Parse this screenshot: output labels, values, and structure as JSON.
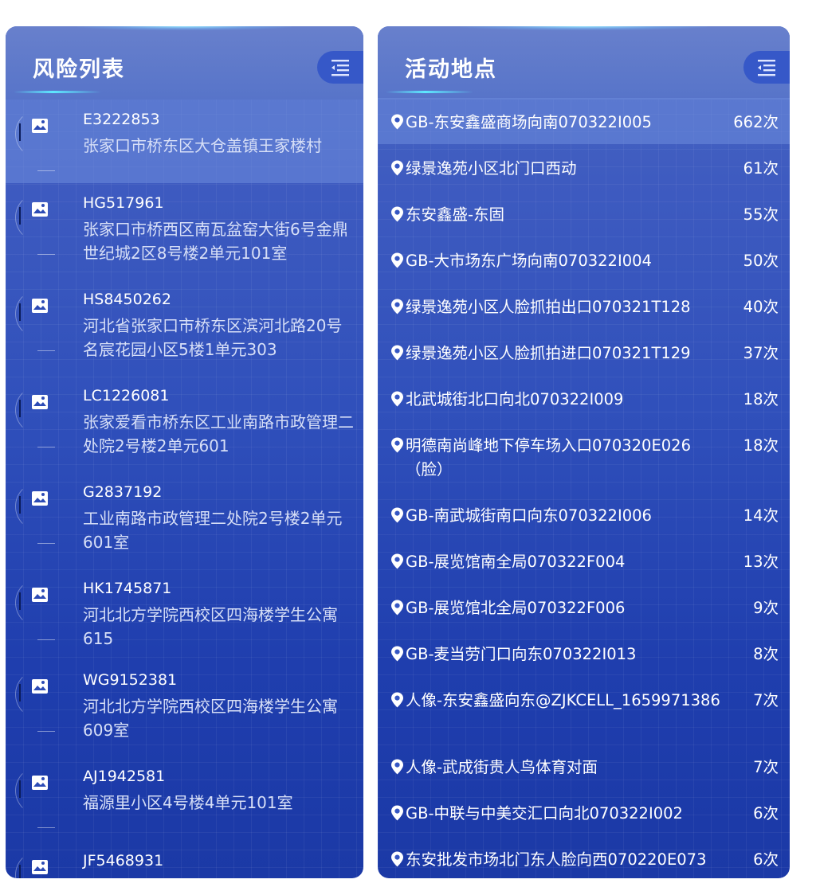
{
  "risk_panel": {
    "title": "风险列表",
    "items": [
      {
        "id": "E3222853",
        "address": "张家口市桥东区大仓盖镇王家楼村"
      },
      {
        "id": "HG517961",
        "address": "张家口市桥西区南瓦盆窑大街6号金鼎世纪城2区8号楼2单元101室"
      },
      {
        "id": "HS8450262",
        "address": "河北省张家口市桥东区滨河北路20号名宸花园小区5楼1单元303"
      },
      {
        "id": "LC1226081",
        "address": "张家爱看市桥东区工业南路市政管理二处院2号楼2单元601"
      },
      {
        "id": "G2837192",
        "address": "工业南路市政管理二处院2号楼2单元601室"
      },
      {
        "id": "HK1745871",
        "address": "河北北方学院西校区四海楼学生公寓615"
      },
      {
        "id": "WG9152381",
        "address": "河北北方学院西校区四海楼学生公寓609室"
      },
      {
        "id": "AJ1942581",
        "address": "福源里小区4号楼4单元101室"
      },
      {
        "id": "JF5468931",
        "address": ""
      }
    ]
  },
  "location_panel": {
    "title": "活动地点",
    "items": [
      {
        "name": "GB-东安鑫盛商场向南070322I005",
        "count": "662次"
      },
      {
        "name": "绿景逸苑小区北门口西动",
        "count": "61次"
      },
      {
        "name": "东安鑫盛-东固",
        "count": "55次"
      },
      {
        "name": "GB-大市场东广场向南070322I004",
        "count": "50次"
      },
      {
        "name": "绿景逸苑小区人脸抓拍出口070321T128",
        "count": "40次"
      },
      {
        "name": "绿景逸苑小区人脸抓拍进口070321T129",
        "count": "37次"
      },
      {
        "name": "北武城街北口向北070322I009",
        "count": "18次"
      },
      {
        "name": "明德南尚峰地下停车场入口070320E026（脸）",
        "count": "18次"
      },
      {
        "name": "GB-南武城街南口向东070322I006",
        "count": "14次"
      },
      {
        "name": "GB-展览馆南全局070322F004",
        "count": "13次"
      },
      {
        "name": "GB-展览馆北全局070322F006",
        "count": "9次"
      },
      {
        "name": "GB-麦当劳门口向东070322I013",
        "count": "8次"
      },
      {
        "name": "人像-东安鑫盛向东@ZJKCELL_1659971386",
        "count": "7次"
      },
      {
        "name": "人像-武成街贵人鸟体育对面",
        "count": "7次"
      },
      {
        "name": "GB-中联与中美交汇口向北070322I002",
        "count": "6次"
      },
      {
        "name": "东安批发市场北门东人脸向西070220E073",
        "count": "6次"
      }
    ]
  },
  "icons": {
    "risk_item": "image-placeholder-icon",
    "location_item": "location-pin-icon",
    "toggle": "collapse-menu-icon"
  },
  "colors": {
    "panel_top": "#4b68c3",
    "panel_bottom": "#1b39a6",
    "accent": "#5ee8ff",
    "toggle_bg": "#3658c8"
  }
}
